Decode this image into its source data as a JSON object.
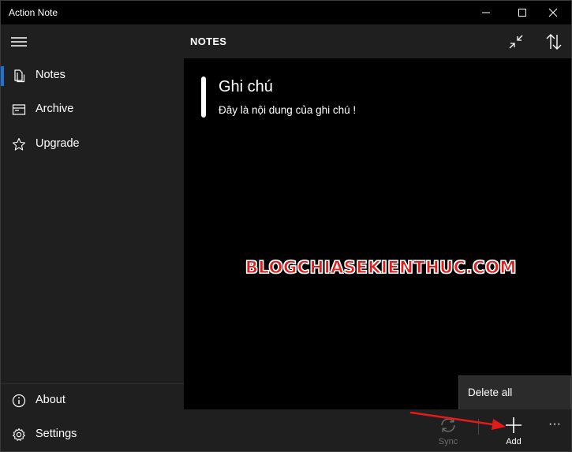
{
  "window": {
    "title": "Action Note"
  },
  "sidebar": {
    "items": [
      {
        "label": "Notes",
        "icon": "notes-icon",
        "selected": true
      },
      {
        "label": "Archive",
        "icon": "archive-icon",
        "selected": false
      },
      {
        "label": "Upgrade",
        "icon": "star-icon",
        "selected": false
      }
    ],
    "footer": [
      {
        "label": "About",
        "icon": "info-icon"
      },
      {
        "label": "Settings",
        "icon": "gear-icon"
      }
    ]
  },
  "main": {
    "header_title": "NOTES",
    "note": {
      "title": "Ghi chú",
      "body": "Đây là nội dung của ghi chú !"
    },
    "watermark": "BLOGCHIASEKIENTHUC.COM"
  },
  "popup": {
    "delete_all": "Delete all"
  },
  "commandbar": {
    "sync_label": "Sync",
    "add_label": "Add",
    "more": "···"
  },
  "colors": {
    "accent": "#1e73d2",
    "annotation": "#e21a1a"
  }
}
